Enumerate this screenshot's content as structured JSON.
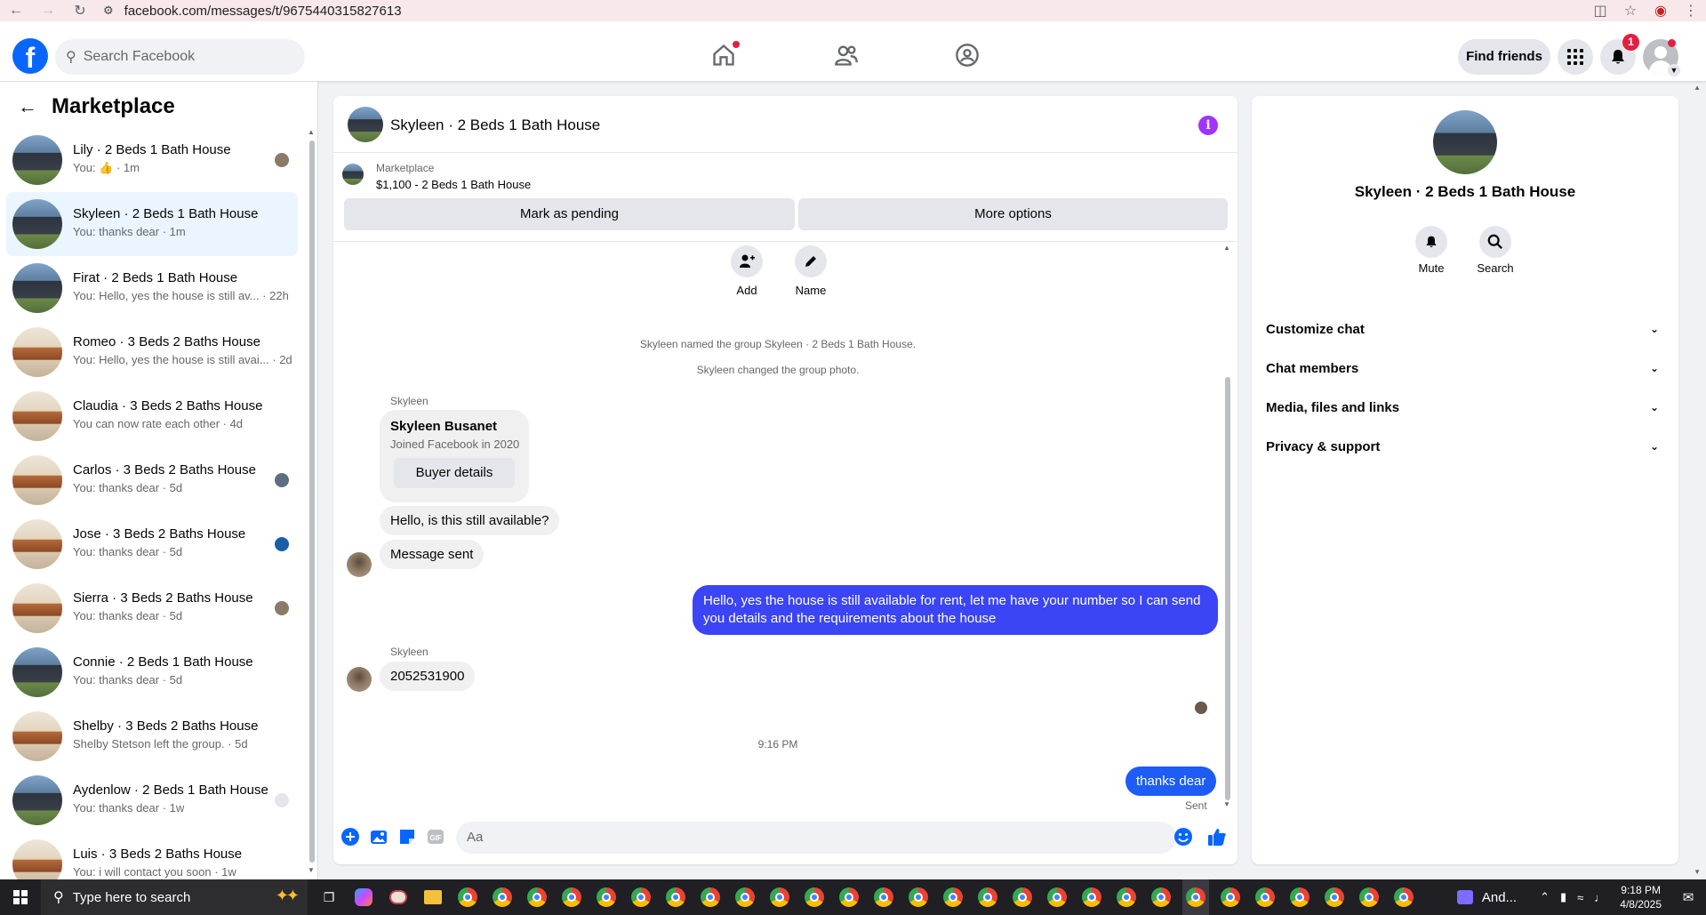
{
  "browser": {
    "url": "facebook.com/messages/t/9675440315827613"
  },
  "fb_nav": {
    "logo_letter": "f",
    "search_placeholder": "Search Facebook",
    "find_friends": "Find friends",
    "notification_count": "1"
  },
  "sidebar": {
    "title": "Marketplace",
    "items": [
      {
        "title": "Lily · 2 Beds 1 Bath House",
        "sub": "You: 👍 · 1m",
        "thumb": "house",
        "seen": "brown",
        "active": false
      },
      {
        "title": "Skyleen · 2 Beds 1 Bath House",
        "sub": "You: thanks dear · 1m",
        "thumb": "house",
        "seen": "",
        "active": true
      },
      {
        "title": "Firat · 2 Beds 1 Bath House",
        "sub": "You: Hello, yes the house is still av... · 22h",
        "thumb": "house",
        "seen": "",
        "active": false
      },
      {
        "title": "Romeo · 3 Beds 2 Baths House",
        "sub": "You: Hello, yes the house is still avai... · 2d",
        "thumb": "interior",
        "seen": "",
        "active": false
      },
      {
        "title": "Claudia · 3 Beds 2 Baths House",
        "sub": "You can now rate each other · 4d",
        "thumb": "interior",
        "seen": "",
        "active": false
      },
      {
        "title": "Carlos · 3 Beds 2 Baths House",
        "sub": "You: thanks dear · 5d",
        "thumb": "interior",
        "seen": "slate",
        "active": false
      },
      {
        "title": "Jose · 3 Beds 2 Baths House",
        "sub": "You: thanks dear · 5d",
        "thumb": "interior",
        "seen": "blue",
        "active": false
      },
      {
        "title": "Sierra · 3 Beds 2 Baths House",
        "sub": "You: thanks dear · 5d",
        "thumb": "interior",
        "seen": "brown",
        "active": false
      },
      {
        "title": "Connie · 2 Beds 1 Bath House",
        "sub": "You: thanks dear · 5d",
        "thumb": "house",
        "seen": "",
        "active": false
      },
      {
        "title": "Shelby · 3 Beds 2 Baths House",
        "sub": "Shelby Stetson left the group. · 5d",
        "thumb": "interior",
        "seen": "",
        "active": false
      },
      {
        "title": "Aydenlow · 2 Beds 1 Bath House",
        "sub": "You: thanks dear · 1w",
        "thumb": "house",
        "seen": "grey",
        "active": false
      },
      {
        "title": "Luis · 3 Beds 2 Baths House",
        "sub": "You: i will contact you soon · 1w",
        "thumb": "interior",
        "seen": "",
        "active": false
      }
    ]
  },
  "chat": {
    "title": "Skyleen · 2 Beds 1 Bath House",
    "marketplace_label": "Marketplace",
    "listing": "$1,100 - 2 Beds 1 Bath House",
    "mark_pending": "Mark as pending",
    "more_options": "More options",
    "add_label": "Add",
    "name_label": "Name",
    "sys_msg_1": "Skyleen named the group Skyleen · 2 Beds 1 Bath House.",
    "sys_msg_2": "Skyleen changed the group photo.",
    "sender_1": "Skyleen",
    "card_name": "Skyleen Busanet",
    "card_sub": "Joined Facebook in 2020",
    "card_button": "Buyer details",
    "msg_in_1": "Hello, is this still available?",
    "msg_in_2": "Message sent",
    "msg_out_1": "Hello, yes the house is still available for rent, let me have your number so I can send you details and the requirements about the house",
    "sender_2": "Skyleen",
    "msg_in_3": "2052531900",
    "time_sep": "9:16 PM",
    "msg_out_2": "thanks dear",
    "sent_status": "Sent",
    "composer_placeholder": "Aa"
  },
  "info_panel": {
    "title": "Skyleen · 2 Beds 1 Bath House",
    "mute": "Mute",
    "search": "Search",
    "rows": [
      "Customize chat",
      "Chat members",
      "Media, files and links",
      "Privacy & support"
    ]
  },
  "taskbar": {
    "search_placeholder": "Type here to search",
    "app_label": "And...",
    "time": "9:18 PM",
    "date": "4/8/2025"
  },
  "colors": {
    "fb_blue": "#0866ff",
    "outgoing_bubble": "#3b45f5",
    "active_conv": "#ebf5ff",
    "info_icon": "#a033ff",
    "badge_red": "#e41e3f"
  }
}
